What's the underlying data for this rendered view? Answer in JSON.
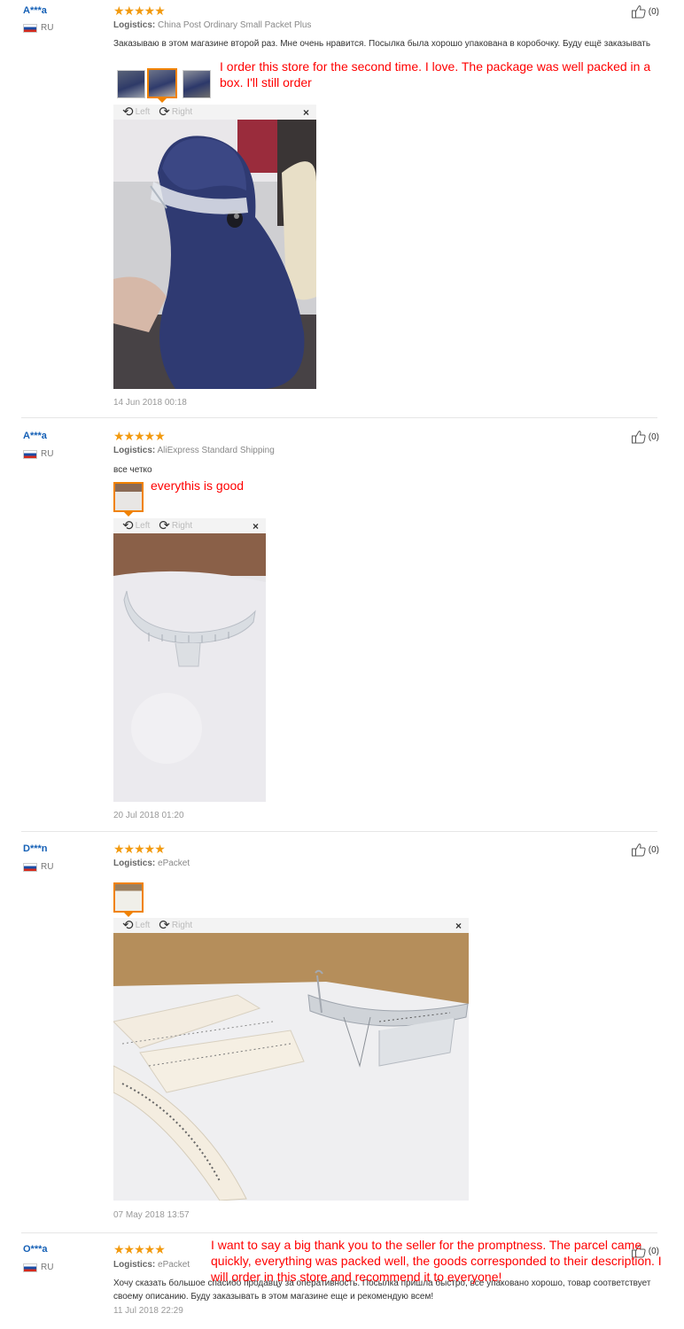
{
  "reviews": [
    {
      "user": "A***a",
      "country": "RU",
      "stars": "★★★★★",
      "logistics_label": "Logistics:",
      "logistics": "China Post Ordinary Small Packet Plus",
      "text": "Заказываю в этом магазине второй раз. Мне очень нравится. Посылка была хорошо упакована в коробочку. Буду ещё заказывать",
      "translation": "I order this store for the second time. I love. The package was well packed in a box. I'll still order",
      "likes": "(0)",
      "viewer": {
        "left": "Left",
        "right": "Right",
        "close": "×"
      },
      "date": "14 Jun 2018 00:18"
    },
    {
      "user": "A***a",
      "country": "RU",
      "stars": "★★★★★",
      "logistics_label": "Logistics:",
      "logistics": "AliExpress Standard Shipping",
      "text": "все четко",
      "translation": "everythis is good",
      "likes": "(0)",
      "viewer": {
        "left": "Left",
        "right": "Right",
        "close": "×"
      },
      "date": "20 Jul 2018 01:20"
    },
    {
      "user": "D***n",
      "country": "RU",
      "stars": "★★★★★",
      "logistics_label": "Logistics:",
      "logistics": "ePacket",
      "text": "",
      "translation": "",
      "likes": "(0)",
      "viewer": {
        "left": "Left",
        "right": "Right",
        "close": "×"
      },
      "date": "07 May 2018 13:57"
    },
    {
      "user": "O***a",
      "country": "RU",
      "stars": "★★★★★",
      "logistics_label": "Logistics:",
      "logistics": "ePacket",
      "text": "Хочу сказать большое спасибо продавцу за оперативность. Посылка пришла быстро, все упаковано хорошо, товар соответствует своему описанию. Буду заказывать в этом магазине еще и рекомендую всем!",
      "translation": "I want to say a big thank you to the seller for the promptness. The parcel came quickly, everything was packed well, the goods corresponded to their description. I will order in this store and recommend it to everyone!",
      "likes": "(0)",
      "date": "11 Jul 2018 22:29"
    }
  ],
  "colors": {
    "username": "#1560b6",
    "stars": "#f29a0f",
    "translation": "#ff0000",
    "active_thumb": "#f08200"
  },
  "icons": {
    "like": "thumbs-up-icon",
    "rotate_left": "rotate-left-icon",
    "rotate_right": "rotate-right-icon",
    "close": "close-icon",
    "flag": "russia-flag-icon"
  }
}
